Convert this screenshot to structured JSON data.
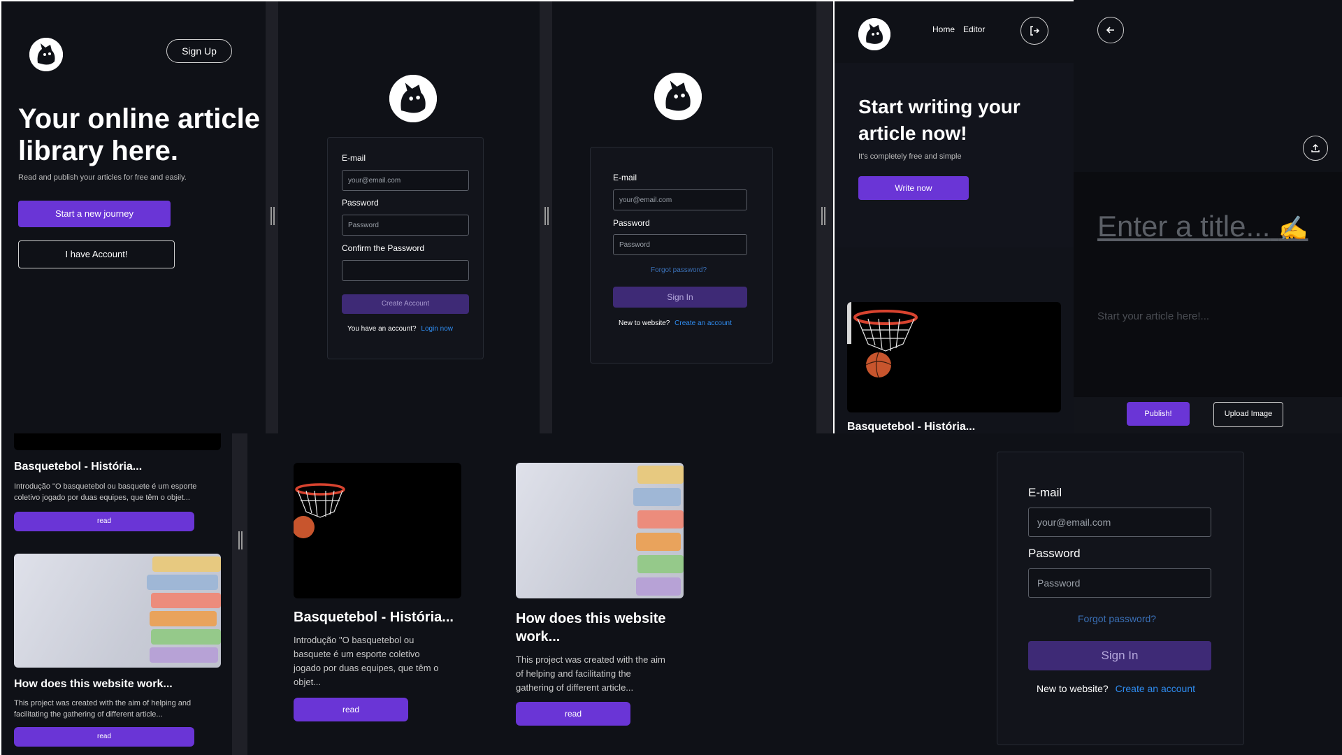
{
  "landing": {
    "signup_label": "Sign Up",
    "headline_line1": "Your online article",
    "headline_line2": "library here.",
    "subtext": "Read and publish your articles for free and easily.",
    "start_button": "Start a new journey",
    "account_button": "I have Account!"
  },
  "signup_form": {
    "email_label": "E-mail",
    "email_placeholder": "your@email.com",
    "password_label": "Password",
    "password_placeholder": "Password",
    "confirm_label": "Confirm the Password",
    "create_button": "Create Account",
    "have_account_text": "You have an account?",
    "login_link": "Login now"
  },
  "signin_small": {
    "email_label": "E-mail",
    "email_placeholder": "your@email.com",
    "password_label": "Password",
    "password_placeholder": "Password",
    "forgot_link": "Forgot password?",
    "signin_button": "Sign In",
    "new_text": "New to website?",
    "create_link": "Create an account"
  },
  "home": {
    "nav_home": "Home",
    "nav_editor": "Editor",
    "headline_line1": "Start writing your",
    "headline_line2": "article now!",
    "subtext": "It's completely free and simple",
    "write_button": "Write now",
    "card_title": "Basquetebol - História..."
  },
  "editor": {
    "title_placeholder": "Enter a title...",
    "body_placeholder": "Start your article here!...",
    "publish_button": "Publish!",
    "upload_button": "Upload Image"
  },
  "mobile_list": {
    "card1_title": "Basquetebol - História...",
    "card1_desc_line1": "Introdução \"O basquetebol ou basquete é um esporte",
    "card1_desc_line2": "coletivo jogado por duas equipes, que têm o objet...",
    "card2_title": "How does this website work...",
    "card2_desc_line1": "This project was created with the aim of helping and",
    "card2_desc_line2": "facilitating the gathering of different article...",
    "read_label": "read"
  },
  "grid_list": {
    "card1_title": "Basquetebol - História...",
    "card1_desc_lines": [
      "Introdução \"O basquetebol ou",
      "basquete é um esporte coletivo",
      "jogado por duas equipes, que têm o",
      "objet..."
    ],
    "card2_title_line1": "How does this website",
    "card2_title_line2": "work...",
    "card2_desc_lines": [
      "This project was created with the aim",
      "of helping and facilitating the",
      "gathering of different article..."
    ],
    "read_label": "read"
  },
  "signin_large": {
    "email_label": "E-mail",
    "email_placeholder": "your@email.com",
    "password_label": "Password",
    "password_placeholder": "Password",
    "forgot_link": "Forgot password?",
    "signin_button": "Sign In",
    "new_text": "New to website?",
    "create_link": "Create an account"
  },
  "colors": {
    "background": "#0f1117",
    "accent": "#6a35d6",
    "accent_dark": "#3e2a76",
    "link": "#2f8cf0"
  }
}
